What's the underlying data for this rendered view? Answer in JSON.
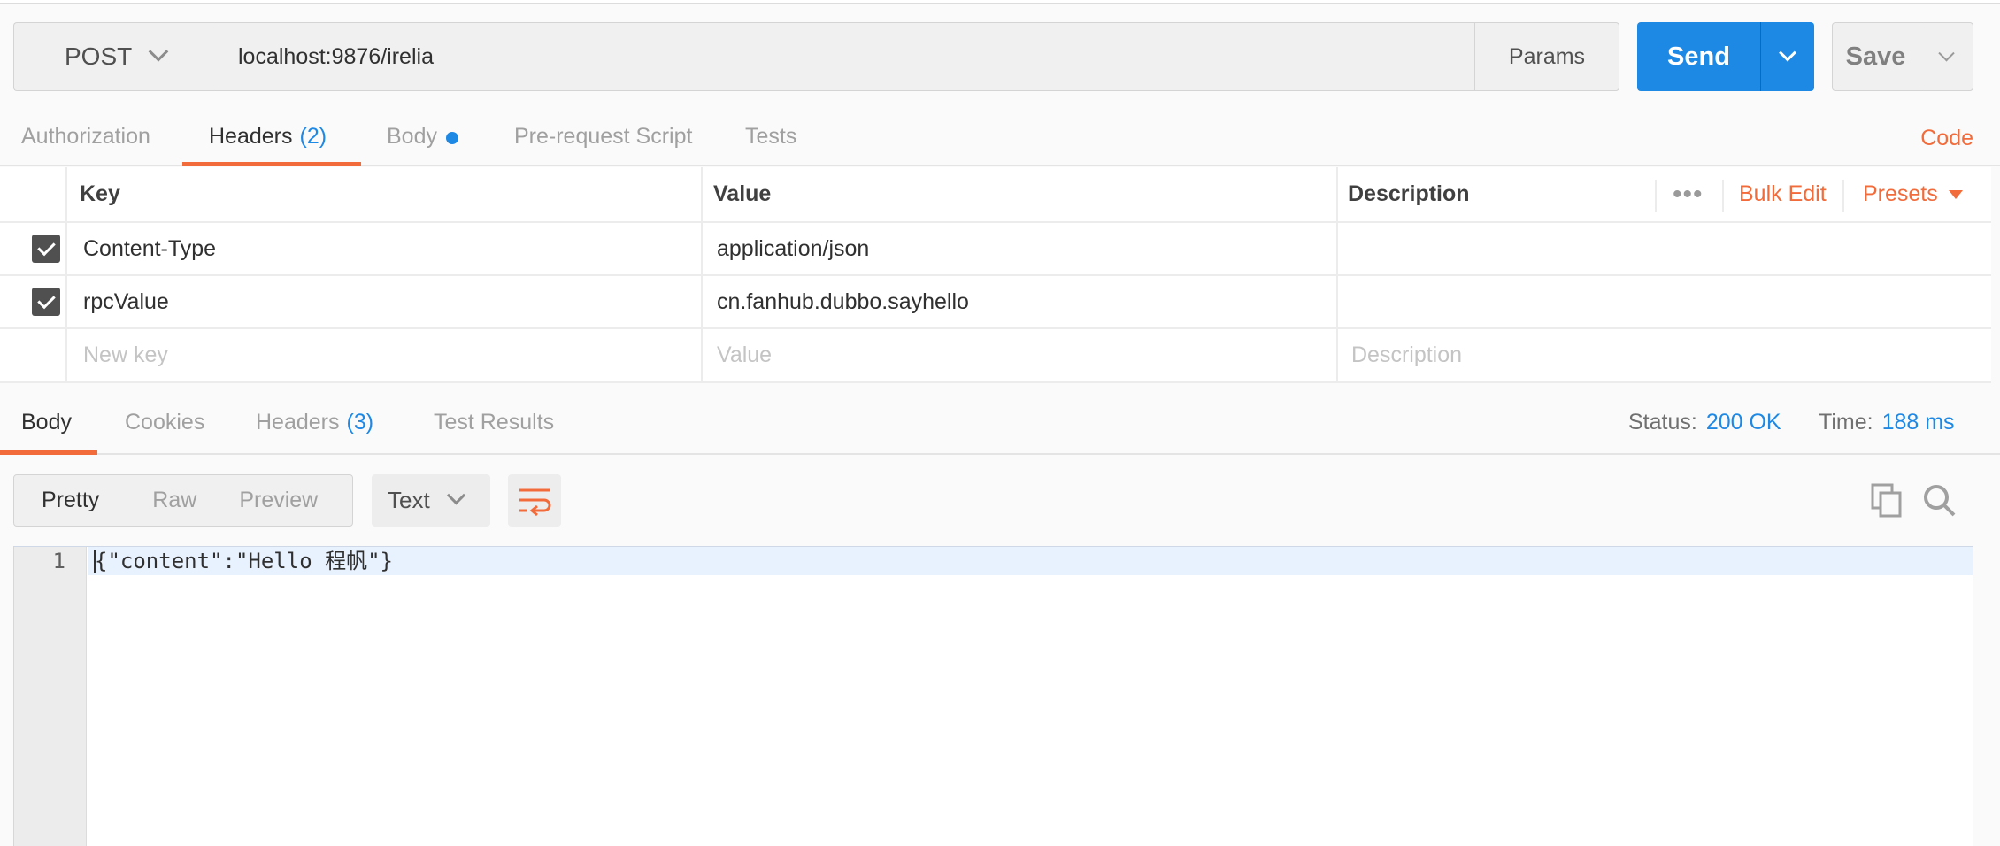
{
  "request": {
    "method": "POST",
    "url": "localhost:9876/irelia",
    "params_label": "Params",
    "send_label": "Send",
    "save_label": "Save"
  },
  "request_tabs": [
    {
      "label": "Authorization",
      "count": ""
    },
    {
      "label": "Headers",
      "count": "(2)"
    },
    {
      "label": "Body",
      "count": ""
    },
    {
      "label": "Pre-request Script",
      "count": ""
    },
    {
      "label": "Tests",
      "count": ""
    }
  ],
  "active_request_tab": "Headers",
  "code_link": "Code",
  "headers_table": {
    "columns": {
      "key": "Key",
      "value": "Value",
      "description": "Description"
    },
    "more_label": "•••",
    "bulk_edit_label": "Bulk Edit",
    "presets_label": "Presets",
    "rows": [
      {
        "checked": true,
        "key": "Content-Type",
        "value": "application/json",
        "description": ""
      },
      {
        "checked": true,
        "key": "rpcValue",
        "value": "cn.fanhub.dubbo.sayhello",
        "description": ""
      }
    ],
    "new_row": {
      "key_placeholder": "New key",
      "value_placeholder": "Value",
      "description_placeholder": "Description"
    }
  },
  "response_tabs": [
    {
      "label": "Body",
      "count": ""
    },
    {
      "label": "Cookies",
      "count": ""
    },
    {
      "label": "Headers",
      "count": "(3)"
    },
    {
      "label": "Test Results",
      "count": ""
    }
  ],
  "active_response_tab": "Body",
  "status": {
    "status_label": "Status:",
    "status_value": "200 OK",
    "time_label": "Time:",
    "time_value": "188 ms"
  },
  "view_modes": [
    "Pretty",
    "Raw",
    "Preview"
  ],
  "active_view_mode": "Pretty",
  "format": "Text",
  "colors": {
    "accent_blue": "#1e88e5",
    "accent_orange": "#f26b3a"
  },
  "editor": {
    "lines": [
      {
        "number": "1",
        "text": "{\"content\":\"Hello 程帆\"}"
      }
    ]
  }
}
